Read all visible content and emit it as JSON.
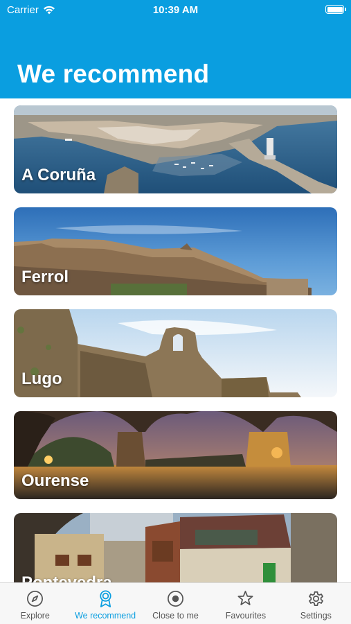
{
  "status_bar": {
    "carrier": "Carrier",
    "time": "10:39 AM"
  },
  "header": {
    "title": "We recommend",
    "color": "#0a9ee0"
  },
  "cities": [
    {
      "name": "A Coruña"
    },
    {
      "name": "Ferrol"
    },
    {
      "name": "Lugo"
    },
    {
      "name": "Ourense"
    },
    {
      "name": "Pontevedra"
    }
  ],
  "tabbar": {
    "items": [
      {
        "label": "Explore",
        "icon": "compass-icon",
        "active": false
      },
      {
        "label": "We recommend",
        "icon": "ribbon-icon",
        "active": true
      },
      {
        "label": "Close to me",
        "icon": "target-icon",
        "active": false
      },
      {
        "label": "Favourites",
        "icon": "star-icon",
        "active": false
      },
      {
        "label": "Settings",
        "icon": "gear-icon",
        "active": false
      }
    ],
    "active_color": "#0a9ee0"
  }
}
